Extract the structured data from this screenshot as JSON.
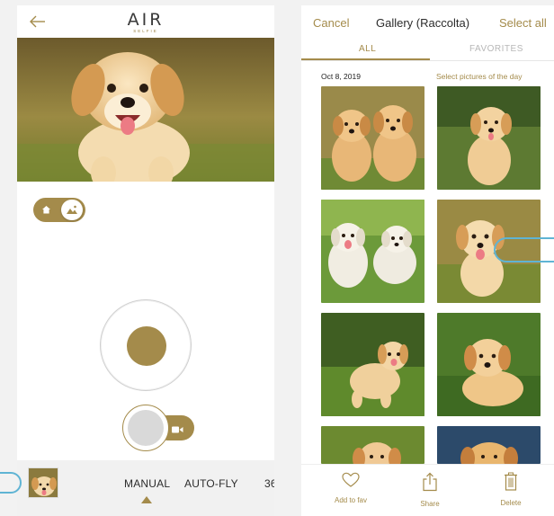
{
  "camera_screen": {
    "back_icon": "left-arrow-icon",
    "logo": {
      "big": "AIR",
      "small": "SELFIE"
    },
    "hero_photo": "golden-retriever-puppy-running",
    "mode_toggle": {
      "left_icon": "home-icon",
      "right_icon": "landscape-icon"
    },
    "video_toggle_icon": "video-camera-icon",
    "thumbnail": "puppy-thumbnail",
    "modes": [
      "MANUAL",
      "AUTO-FLY",
      "36"
    ],
    "selected_mode": "MANUAL"
  },
  "gallery_screen": {
    "cancel_label": "Cancel",
    "title": "Gallery (Raccolta)",
    "select_all_label": "Select all",
    "tabs": [
      "ALL",
      "FAVORITES"
    ],
    "active_tab": "ALL",
    "date": "Oct 8, 2019",
    "select_day_label": "Select pictures of the day",
    "photos": [
      "two-puppies",
      "puppy-sitting",
      "two-white-puppies",
      "puppy-running-grass",
      "puppy-playing-grass",
      "puppy-lying",
      "puppy-bottom-left",
      "puppy-bottom-right"
    ],
    "actions": [
      {
        "label": "Add to fav",
        "icon": "heart-icon"
      },
      {
        "label": "Share",
        "icon": "share-icon"
      },
      {
        "label": "Delete",
        "icon": "trash-icon"
      }
    ]
  },
  "colors": {
    "accent": "#a48b4b",
    "background": "#f2f2f2",
    "text": "#2c2c2c",
    "muted": "#b7b7b7",
    "hint": "#5fb4d4"
  }
}
